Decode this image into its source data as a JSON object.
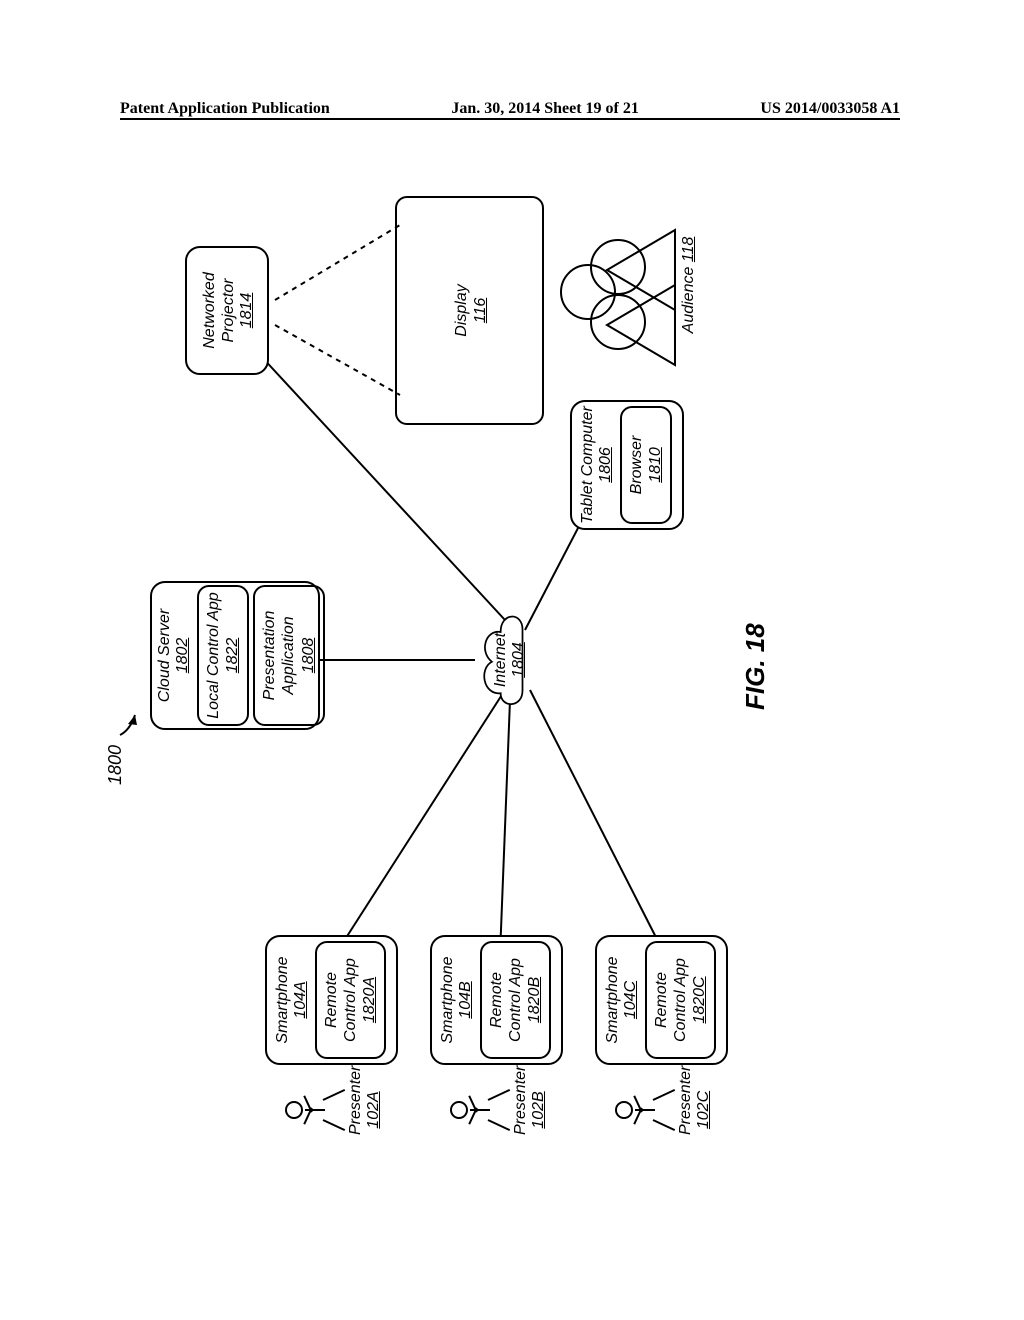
{
  "header": {
    "left": "Patent Application Publication",
    "center": "Jan. 30, 2014   Sheet 19 of 21",
    "right": "US 2014/0033058 A1"
  },
  "ref_number": "1800",
  "figure_label": "FIG. 18",
  "nodes": {
    "cloud_server": {
      "name": "Cloud Server",
      "ref": "1802",
      "local_app": {
        "name": "Local Control App",
        "ref": "1822"
      },
      "pres_app": {
        "name": "Presentation Application",
        "ref": "1808"
      }
    },
    "internet": {
      "name": "Internet",
      "ref": "1804"
    },
    "phoneA": {
      "name": "Smartphone",
      "ref": "104A",
      "app": {
        "name": "Remote Control App",
        "ref": "1820A"
      }
    },
    "phoneB": {
      "name": "Smartphone",
      "ref": "104B",
      "app": {
        "name": "Remote Control App",
        "ref": "1820B"
      }
    },
    "phoneC": {
      "name": "Smartphone",
      "ref": "104C",
      "app": {
        "name": "Remote Control App",
        "ref": "1820C"
      }
    },
    "presenterA": {
      "name": "Presenter",
      "ref": "102A"
    },
    "presenterB": {
      "name": "Presenter",
      "ref": "102B"
    },
    "presenterC": {
      "name": "Presenter",
      "ref": "102C"
    },
    "projector": {
      "name": "Networked Projector",
      "ref": "1814"
    },
    "display": {
      "name": "Display",
      "ref": "116"
    },
    "tablet": {
      "name": "Tablet Computer",
      "ref": "1806",
      "browser": {
        "name": "Browser",
        "ref": "1810"
      }
    },
    "audience": {
      "name": "Audience",
      "ref": "118"
    }
  }
}
